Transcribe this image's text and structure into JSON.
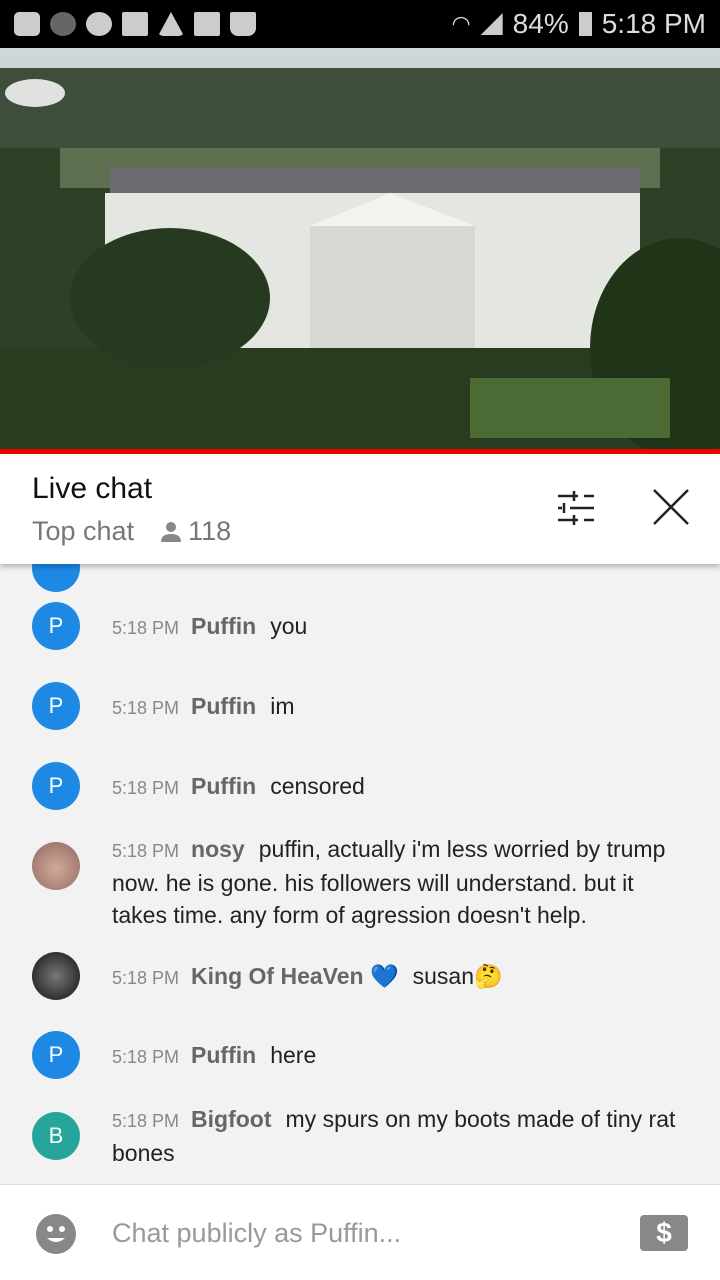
{
  "status_bar": {
    "battery": "84%",
    "time": "5:18 PM",
    "icons": [
      "youtube-icon",
      "m-app-icon",
      "m-app-icon",
      "folder-icon",
      "warning-icon",
      "image-icon",
      "shopping-bag-icon",
      "wifi-icon",
      "signal-icon",
      "battery-icon"
    ]
  },
  "header": {
    "title": "Live chat",
    "mode": "Top chat",
    "viewers": "118"
  },
  "messages": [
    {
      "time": "5:18 PM",
      "author": "Puffin",
      "initial": "P",
      "color": "#1e88e5",
      "text": "you"
    },
    {
      "time": "5:18 PM",
      "author": "Puffin",
      "initial": "P",
      "color": "#1e88e5",
      "text": "im"
    },
    {
      "time": "5:18 PM",
      "author": "Puffin",
      "initial": "P",
      "color": "#1e88e5",
      "text": "censored"
    },
    {
      "time": "5:18 PM",
      "author": "nosy",
      "initial": "",
      "color": "#b08878",
      "text": "puffin, actually i'm less worried by trump now. he is gone. his followers will understand. but it takes time. any form of agression doesn't help."
    },
    {
      "time": "5:18 PM",
      "author": "King Of HeaVen 💙",
      "initial": "",
      "color": "#222",
      "text": "susan🤔"
    },
    {
      "time": "5:18 PM",
      "author": "Puffin",
      "initial": "P",
      "color": "#1e88e5",
      "text": "here"
    },
    {
      "time": "5:18 PM",
      "author": "Bigfoot",
      "initial": "B",
      "color": "#26a69a",
      "text": "my spurs on my boots made of tiny rat bones"
    }
  ],
  "input": {
    "placeholder": "Chat publicly as Puffin...",
    "money_icon": "$"
  },
  "colors": {
    "accent": "#e00000"
  }
}
